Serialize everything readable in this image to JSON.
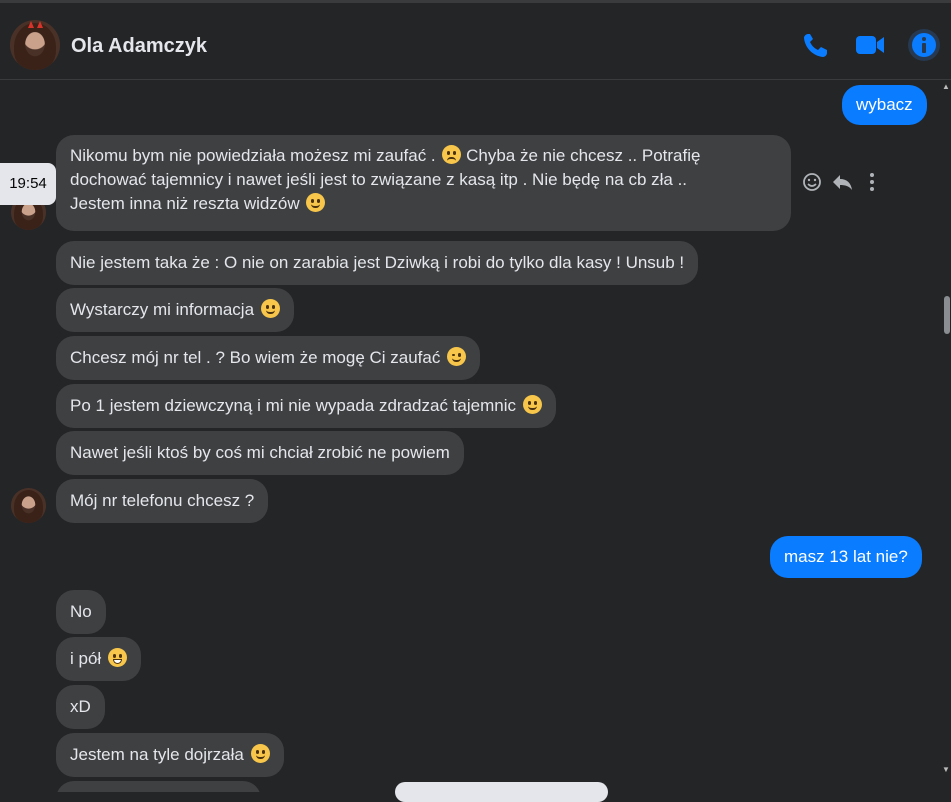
{
  "header": {
    "contact_name": "Ola Adamczyk",
    "icons": [
      "phone-icon",
      "video-camera-icon",
      "info-icon"
    ]
  },
  "timestamp": "19:54",
  "messages": [
    {
      "side": "out",
      "text": "wybacz"
    },
    {
      "side": "in",
      "lines": [
        "Nikomu bym nie powiedziała możesz mi zaufać .",
        "Chyba że nie chcesz .. Potrafię",
        "dochować tajemnicy i nawet jeśli jest to związane z kasą itp . Nie będę na cb zła ..",
        "Jestem inna niż reszta widzów"
      ],
      "emoji": [
        "frowning-face",
        "slightly-smiling-face"
      ]
    },
    {
      "side": "in",
      "text": "Nie jestem taka że : O nie on zarabia jest Dziwką i robi do tylko dla kasy ! Unsub  !"
    },
    {
      "side": "in",
      "text": "Wystarczy mi informacja",
      "emoji": "slightly-smiling-face"
    },
    {
      "side": "in",
      "text": "Chcesz mój nr tel . ? Bo wiem że mogę Ci zaufać",
      "emoji": "winking-face"
    },
    {
      "side": "in",
      "text": "Po 1 jestem dziewczyną i mi nie wypada zdradzać tajemnic",
      "emoji": "slightly-smiling-face"
    },
    {
      "side": "in",
      "text": "Nawet jeśli ktoś by coś mi chciał zrobić ne powiem"
    },
    {
      "side": "in",
      "text": "Mój nr telefonu chcesz ?"
    },
    {
      "side": "out",
      "text": "masz 13 lat nie?"
    },
    {
      "side": "in",
      "text": "No"
    },
    {
      "side": "in",
      "text": "i pół",
      "emoji": "grinning-face"
    },
    {
      "side": "in",
      "text": "xD"
    },
    {
      "side": "in",
      "text": "Jestem na tyle dojrzała",
      "emoji": "smiling-face"
    }
  ],
  "message_actions": [
    "react-icon",
    "reply-icon",
    "more-icon"
  ],
  "colors": {
    "background": "#242526",
    "incoming_bubble": "#3e4042",
    "outgoing_bubble": "#0a7cff",
    "accent": "#0a7cff"
  }
}
